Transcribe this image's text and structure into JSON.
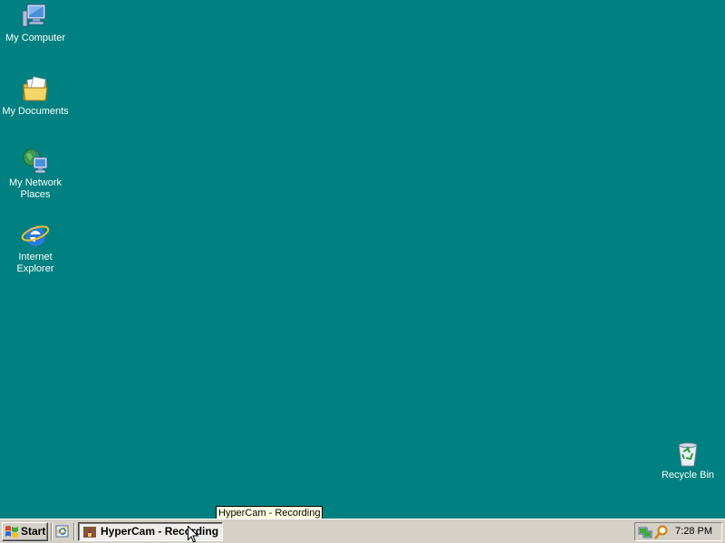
{
  "desktop": {
    "background_color": "#008080",
    "icons": [
      {
        "label": "My Computer",
        "icon": "my-computer-icon"
      },
      {
        "label": "My Documents",
        "icon": "my-documents-icon"
      },
      {
        "label": "My Network Places",
        "icon": "my-network-places-icon"
      },
      {
        "label": "Internet Explorer",
        "icon": "internet-explorer-icon"
      },
      {
        "label": "Recycle Bin",
        "icon": "recycle-bin-icon"
      }
    ]
  },
  "tooltip": {
    "text": "HyperCam - Recording"
  },
  "taskbar": {
    "start_label": "Start",
    "quick_launch": [
      {
        "icon": "show-desktop-ie-icon"
      }
    ],
    "tasks": [
      {
        "label": "HyperCam - Recording",
        "icon": "hypercam-icon"
      }
    ],
    "tray": {
      "icons": [
        "network-tray-icon",
        "search-tray-icon"
      ],
      "clock": "7:28 PM"
    }
  }
}
